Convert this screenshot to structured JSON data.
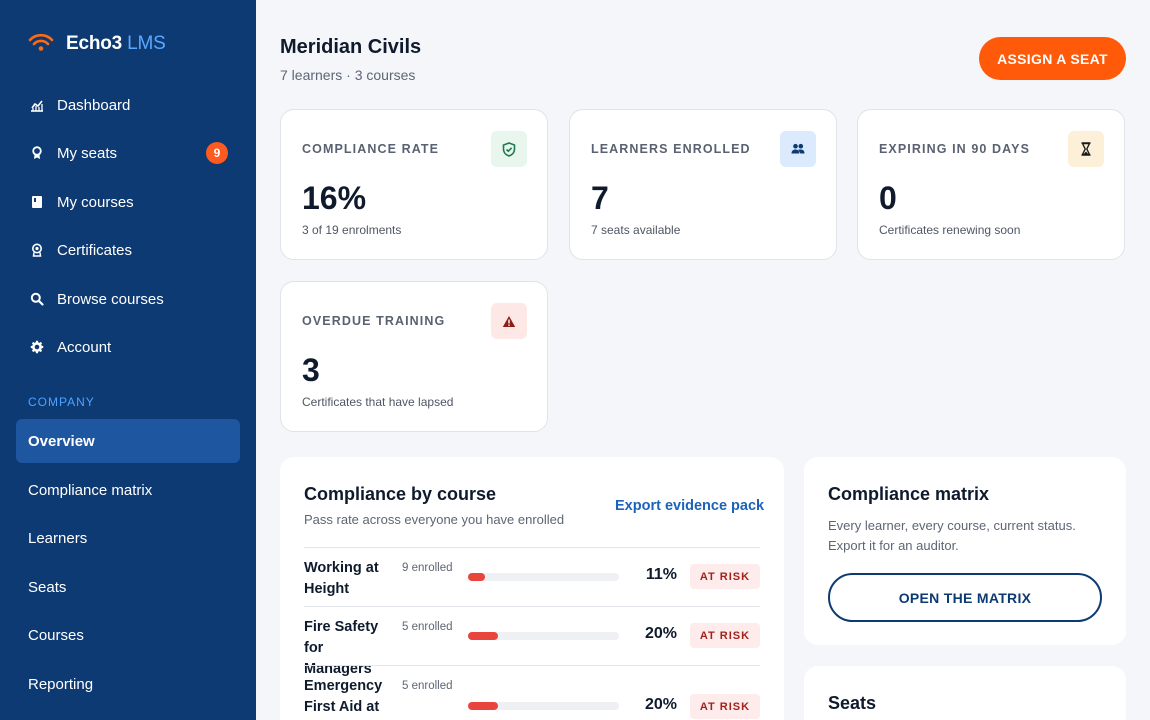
{
  "brand": {
    "name": "Echo3",
    "product": "LMS",
    "logo_icon": "wifi-icon"
  },
  "nav": [
    {
      "label": "Dashboard",
      "icon": "chart-icon"
    },
    {
      "label": "My seats",
      "icon": "seat-icon",
      "badge": "9"
    },
    {
      "label": "My courses",
      "icon": "book-icon"
    },
    {
      "label": "Certificates",
      "icon": "award-icon"
    },
    {
      "label": "Browse courses",
      "icon": "search-icon"
    },
    {
      "label": "Account",
      "icon": "gear-icon"
    }
  ],
  "company_section": {
    "label": "COMPANY",
    "items": [
      {
        "label": "Overview",
        "active": true
      },
      {
        "label": "Compliance matrix"
      },
      {
        "label": "Learners"
      },
      {
        "label": "Seats"
      },
      {
        "label": "Courses"
      },
      {
        "label": "Reporting"
      }
    ]
  },
  "header": {
    "title": "Meridian Civils",
    "subtitle": "7 learners · 3 courses",
    "assign_button": "ASSIGN A SEAT"
  },
  "stats": [
    {
      "label": "COMPLIANCE RATE",
      "value": "16%",
      "note": "3 of 19 enrolments",
      "icon": "shield-check-icon",
      "icon_bg": "#e8f6ee",
      "icon_color": "#1e7a4a"
    },
    {
      "label": "LEARNERS ENROLLED",
      "value": "7",
      "note": "7 seats available",
      "icon": "users-icon",
      "icon_bg": "#dbeafc",
      "icon_color": "#0e3a73"
    },
    {
      "label": "EXPIRING IN 90 DAYS",
      "value": "0",
      "note": "Certificates renewing soon",
      "icon": "hourglass-icon",
      "icon_bg": "#fdf0d9",
      "icon_color": "#1a1a1a"
    },
    {
      "label": "OVERDUE TRAINING",
      "value": "3",
      "note": "Certificates that have lapsed",
      "icon": "warning-icon",
      "icon_bg": "#fde8e6",
      "icon_color": "#8c1d16"
    }
  ],
  "compliance_by_course": {
    "title": "Compliance by course",
    "subtitle": "Pass rate across everyone you have enrolled",
    "export_link": "Export evidence pack",
    "rows": [
      {
        "name": "Working at Height",
        "enrolled": "9 enrolled",
        "pct": "11%",
        "fraction": 0.11,
        "status": "AT RISK"
      },
      {
        "name": "Fire Safety for Managers",
        "enrolled": "5 enrolled",
        "pct": "20%",
        "fraction": 0.2,
        "status": "AT RISK"
      },
      {
        "name": "Emergency First Aid at",
        "enrolled": "5 enrolled",
        "pct": "20%",
        "fraction": 0.2,
        "status": "AT RISK"
      }
    ]
  },
  "matrix_panel": {
    "title": "Compliance matrix",
    "line1": "Every learner, every course, current status.",
    "line2": "Export it for an auditor.",
    "button": "OPEN THE MATRIX"
  },
  "seats_panel": {
    "title": "Seats"
  }
}
